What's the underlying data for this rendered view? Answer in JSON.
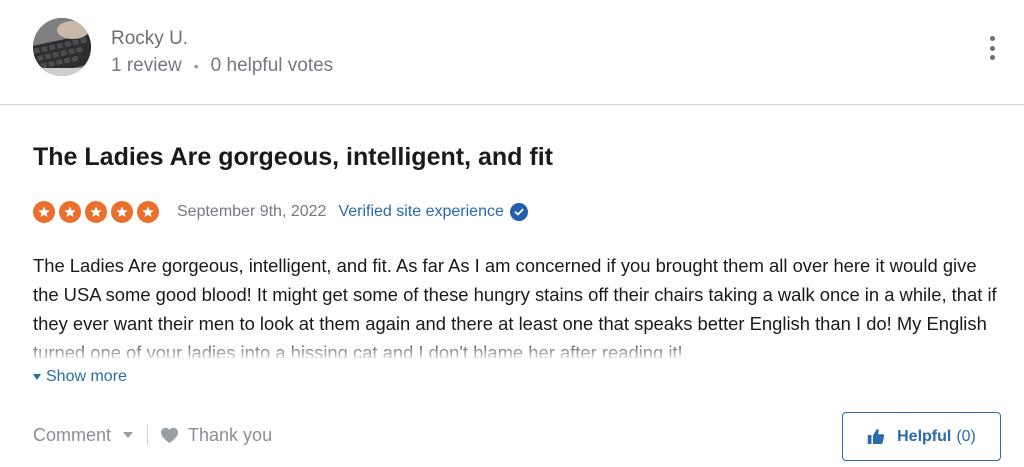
{
  "reviewer": {
    "name": "Rocky U.",
    "reviews": "1 review",
    "separator": "•",
    "helpful_votes": "0 helpful votes",
    "avatar_icon": "keyboard-photo"
  },
  "review": {
    "title": "The Ladies Are gorgeous, intelligent, and fit",
    "rating": 5,
    "rating_max": 5,
    "date": "September 9th, 2022",
    "verified_label": "Verified site experience",
    "body": "The Ladies Are gorgeous, intelligent, and fit. As far As I am concerned if you brought them all over here it would give the USA some good blood! It might get some of these hungry stains off their chairs taking a walk once in a while, that if they ever want their men to look at them again and there at least one that speaks better English than I do! My English turned one of your ladies into a hissing cat and I don't blame her after reading it!",
    "show_more": "Show more"
  },
  "actions": {
    "comment_label": "Comment",
    "thank_label": "Thank you",
    "helpful_label": "Helpful",
    "helpful_count": "(0)"
  },
  "colors": {
    "star": "#e96f2d",
    "link": "#2a6bac",
    "muted": "#757a80"
  }
}
